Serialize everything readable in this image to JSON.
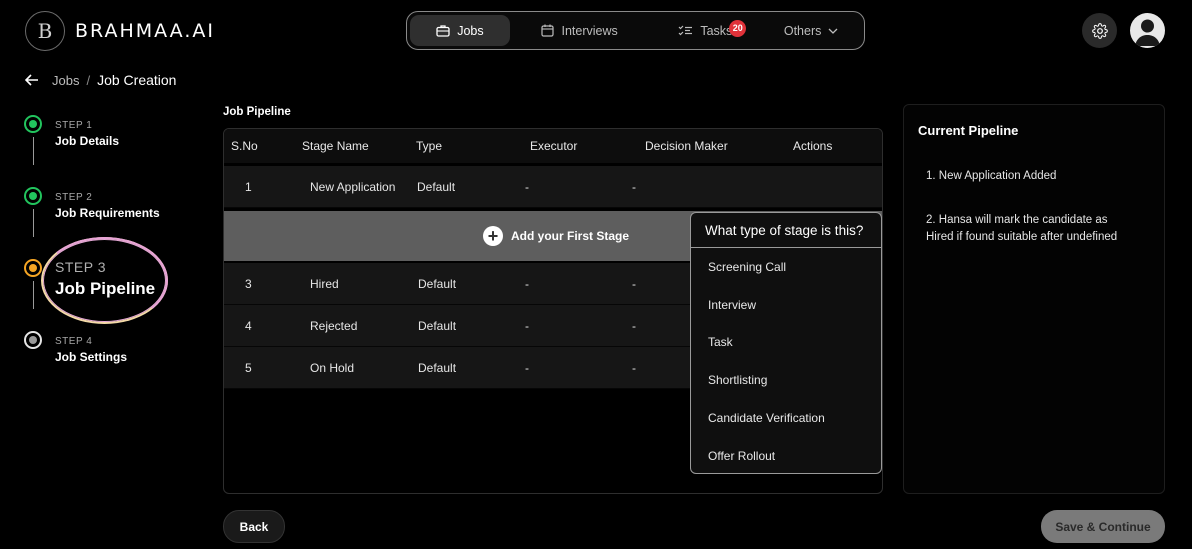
{
  "brand": {
    "mark": "B",
    "name": "BRAHMAA.AI"
  },
  "nav": {
    "items": [
      {
        "label": "Jobs",
        "icon": "briefcase-icon",
        "active": true
      },
      {
        "label": "Interviews",
        "icon": "calendar-icon",
        "active": false
      },
      {
        "label": "Tasks",
        "icon": "task-list-icon",
        "active": false,
        "badge": "20"
      },
      {
        "label": "Others",
        "icon": "chevron-down-icon",
        "active": false
      }
    ]
  },
  "breadcrumb": {
    "parent": "Jobs",
    "separator": "/",
    "current": "Job Creation"
  },
  "steps": [
    {
      "label": "STEP 1",
      "title": "Job Details",
      "status": "completed",
      "color": "#22c55e"
    },
    {
      "label": "STEP 2",
      "title": "Job Requirements",
      "status": "completed",
      "color": "#22c55e"
    },
    {
      "label": "STEP 3",
      "title": "Job Pipeline",
      "status": "current",
      "color": "#f5a524"
    },
    {
      "label": "STEP 4",
      "title": "Job Settings",
      "status": "pending",
      "color": "#e5e5e5"
    }
  ],
  "pipeline": {
    "title": "Job Pipeline",
    "columns": [
      "S.No",
      "Stage Name",
      "Type",
      "Executor",
      "Decision Maker",
      "Actions"
    ],
    "rows": [
      {
        "sno": "1",
        "stage": "New Application",
        "type": "Default",
        "executor": "-",
        "decision_maker": "-"
      },
      {
        "sno": "3",
        "stage": "Hired",
        "type": "Default",
        "executor": "-",
        "decision_maker": "-"
      },
      {
        "sno": "4",
        "stage": "Rejected",
        "type": "Default",
        "executor": "-",
        "decision_maker": "-"
      },
      {
        "sno": "5",
        "stage": "On Hold",
        "type": "Default",
        "executor": "-",
        "decision_maker": "-"
      }
    ],
    "add_stage_label": "Add your First Stage"
  },
  "stage_type_menu": {
    "title": "What type of stage is this?",
    "options": [
      "Screening Call",
      "Interview",
      "Task",
      "Shortlisting",
      "Candidate Verification",
      "Offer Rollout"
    ]
  },
  "current_pipeline": {
    "title": "Current Pipeline",
    "items": [
      "1. New Application Added",
      "2. Hansa will mark the candidate as Hired if found suitable after undefined"
    ]
  },
  "buttons": {
    "back": "Back",
    "save": "Save & Continue"
  }
}
